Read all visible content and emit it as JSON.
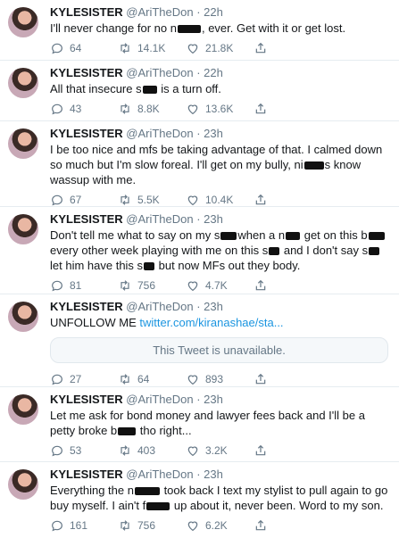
{
  "tweets": [
    {
      "name": "KYLESISTER",
      "handle": "@AriTheDon",
      "time": "22h",
      "parts": [
        "I'll never change for no n",
        null,
        ", ever. Get with it or get lost."
      ],
      "reply": "64",
      "retweet": "14.1K",
      "like": "21.8K"
    },
    {
      "name": "KYLESISTER",
      "handle": "@AriTheDon",
      "time": "22h",
      "parts": [
        "All that insecure s",
        null,
        " is a turn off."
      ],
      "reply": "43",
      "retweet": "8.8K",
      "like": "13.6K"
    },
    {
      "name": "KYLESISTER",
      "handle": "@AriTheDon",
      "time": "23h",
      "parts": [
        "I be too nice and mfs be taking advantage of that. I calmed down so much but I'm slow foreal. I'll get on my bully, ni",
        null,
        "s know wassup with me."
      ],
      "reply": "67",
      "retweet": "5.5K",
      "like": "10.4K"
    },
    {
      "name": "KYLESISTER",
      "handle": "@AriTheDon",
      "time": "23h",
      "parts": [
        "Don't tell me what to say on my s",
        null,
        "when a n",
        null,
        " get on this b",
        null,
        " every other week playing with me on this s",
        null,
        " and I don't say s",
        null,
        " let him have this s",
        null,
        " but now MFs out they body."
      ],
      "reply": "81",
      "retweet": "756",
      "like": "4.7K"
    },
    {
      "name": "KYLESISTER",
      "handle": "@AriTheDon",
      "time": "23h",
      "text": "UNFOLLOW ME",
      "link": "twitter.com/kiranashae/sta...",
      "unavailable": "This Tweet is unavailable.",
      "reply": "27",
      "retweet": "64",
      "like": "893"
    },
    {
      "name": "KYLESISTER",
      "handle": "@AriTheDon",
      "time": "23h",
      "parts": [
        "Let me ask for bond money and lawyer fees back and I'll be a petty broke b",
        null,
        " tho right..."
      ],
      "reply": "53",
      "retweet": "403",
      "like": "3.2K"
    },
    {
      "name": "KYLESISTER",
      "handle": "@AriTheDon",
      "time": "23h",
      "parts": [
        "Everything the n",
        null,
        " took back I text my stylist to pull again to go buy myself. I ain't f",
        null,
        " up about it, never been. Word to my son."
      ],
      "reply": "161",
      "retweet": "756",
      "like": "6.2K"
    }
  ],
  "colors": {
    "text": "#14171a",
    "muted": "#657786",
    "link": "#1b95e0",
    "border": "#e6ecf0"
  },
  "icons": {
    "reply": "reply-icon",
    "retweet": "retweet-icon",
    "like": "heart-icon",
    "share": "share-icon"
  }
}
